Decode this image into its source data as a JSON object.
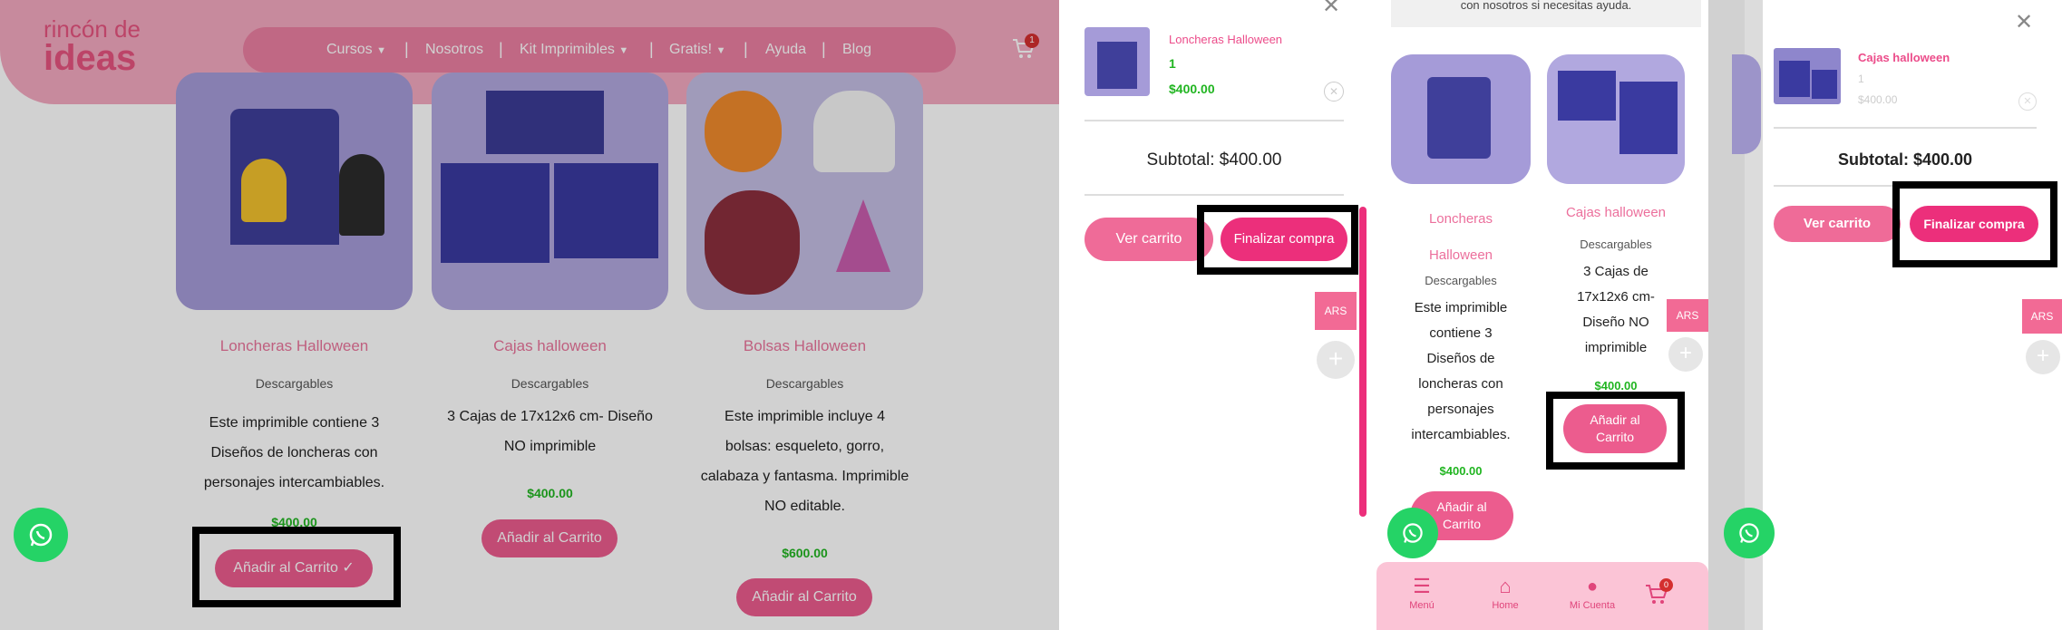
{
  "site": {
    "logo_line1": "rincón de",
    "logo_line2": "ideas",
    "nav": [
      "Cursos",
      "Nosotros",
      "Kit Imprimibles",
      "Gratis!",
      "Ayuda",
      "Blog"
    ],
    "nav_separators": "|",
    "cart_count": "1"
  },
  "products": [
    {
      "title": "Loncheras Halloween",
      "category": "Descargables",
      "desc_lines": [
        "Este imprimible contiene 3",
        "Diseños de loncheras con",
        "personajes intercambiables."
      ],
      "price": "$400.00",
      "button": "Añadir al Carrito",
      "button_check": "✓"
    },
    {
      "title": "Cajas halloween",
      "category": "Descargables",
      "desc_lines": [
        "3 Cajas de 17x12x6 cm- Diseño",
        "NO imprimible"
      ],
      "price": "$400.00",
      "button": "Añadir al Carrito"
    },
    {
      "title": "Bolsas Halloween",
      "category": "Descargables",
      "desc_lines": [
        "Este imprimible incluye 4",
        "bolsas: esqueleto, gorro,",
        "calabaza y fantasma. Imprimible",
        "NO editable."
      ],
      "price": "$600.00",
      "button": "Añadir al Carrito"
    }
  ],
  "cart_panel_1": {
    "item_title": "Loncheras Halloween",
    "item_qty": "1",
    "item_price": "$400.00",
    "subtotal": "Subtotal: $400.00",
    "view_cart": "Ver carrito",
    "checkout": "Finalizar compra",
    "currency": "ARS",
    "close": "✕"
  },
  "mobile": {
    "help_text": "con nosotros si necesitas ayuda.",
    "products": [
      {
        "title_line1": "Loncheras",
        "title_line2": "Halloween",
        "category": "Descargables",
        "desc_lines": [
          "Este imprimible",
          "contiene 3",
          "Diseños de",
          "loncheras con",
          "personajes",
          "intercambiables."
        ],
        "price": "$400.00",
        "button_line1": "Añadir al",
        "button_line2": "Carrito"
      },
      {
        "title": "Cajas halloween",
        "category": "Descargables",
        "desc_lines": [
          "3 Cajas de",
          "17x12x6 cm-",
          "Diseño NO",
          "imprimible"
        ],
        "price": "$400.00",
        "button_line1": "Añadir al",
        "button_line2": "Carrito"
      }
    ],
    "currency": "ARS",
    "bottom_nav": [
      {
        "label": "Menú",
        "icon": "menu-icon"
      },
      {
        "label": "Home",
        "icon": "home-icon"
      },
      {
        "label": "Mi Cuenta",
        "icon": "user-icon"
      },
      {
        "label": "",
        "icon": "cart-icon",
        "badge": "0"
      }
    ]
  },
  "cart_panel_2": {
    "item_title": "Cajas halloween",
    "item_qty": "1",
    "item_price": "$400.00",
    "subtotal": "Subtotal: $400.00",
    "view_cart": "Ver carrito",
    "checkout": "Finalizar compra",
    "currency": "ARS",
    "close": "✕"
  },
  "colors": {
    "brand_pink": "#ec5c8e",
    "header_pink": "#f0a3bb",
    "price_green": "#21b521",
    "whatsapp": "#25d366"
  }
}
